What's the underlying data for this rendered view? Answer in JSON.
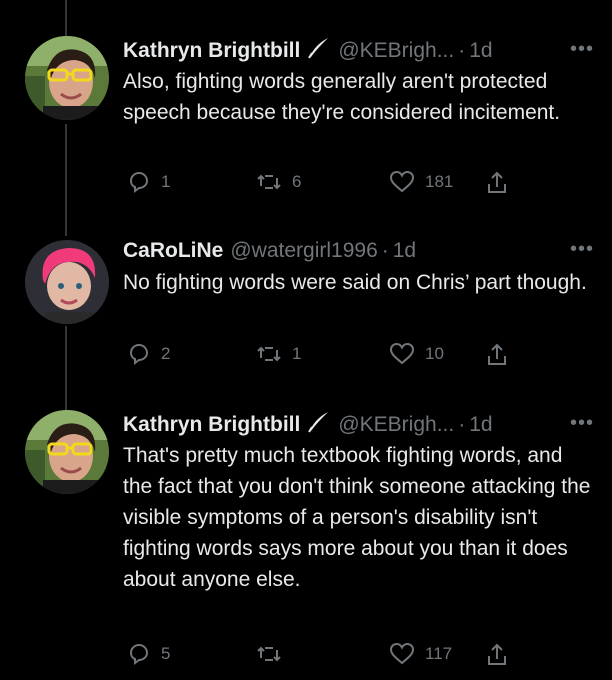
{
  "tweets": [
    {
      "name": "Kathryn Brightbill",
      "handle": "@KEBrigh...",
      "time": "1d",
      "text": "Also, fighting words generally aren't protected speech because they're considered incitement.",
      "replies": "1",
      "retweets": "6",
      "likes": "181",
      "avatar": "woman-yellow-glasses"
    },
    {
      "name": "CaRoLiNe",
      "handle": "@watergirl1996",
      "time": "1d",
      "text": "No fighting words were said on Chris’ part though.",
      "replies": "2",
      "retweets": "1",
      "likes": "10",
      "avatar": "woman-pink-hair"
    },
    {
      "name": "Kathryn Brightbill",
      "handle": "@KEBrigh...",
      "time": "1d",
      "text": "That's pretty much textbook fighting words, and the fact that you don't think someone attacking the visible symptoms of a person's disability isn't fighting words says more about you than it does about anyone else.",
      "replies": "5",
      "retweets": "",
      "likes": "117",
      "avatar": "woman-yellow-glasses"
    }
  ],
  "separator": "·",
  "more_glyph": "•••",
  "colors": {
    "background": "#000000",
    "text": "#e7e9ea",
    "muted": "#71767b",
    "thread_line": "#333639"
  }
}
